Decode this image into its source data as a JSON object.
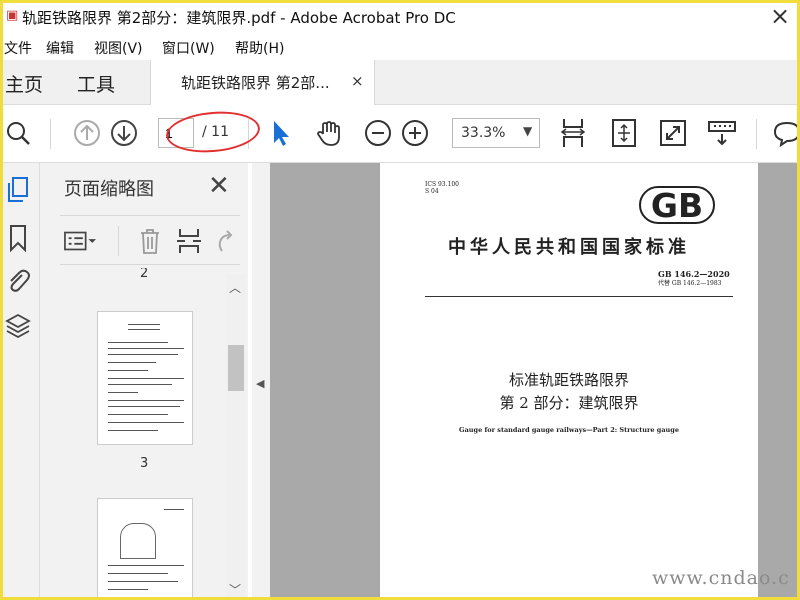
{
  "window": {
    "title": "轨距铁路限界 第2部分：建筑限界.pdf - Adobe Acrobat Pro DC"
  },
  "menu": [
    "文件",
    "编辑",
    "视图(V)",
    "窗口(W)",
    "帮助(H)"
  ],
  "tabs": {
    "home": "主页",
    "tools": "工具",
    "document": "轨距铁路限界 第2部...",
    "close_glyph": "×"
  },
  "toolbar": {
    "page_current": "1",
    "page_total": "/ 11",
    "zoom": "33.3%"
  },
  "thumbnail_panel": {
    "title": "页面缩略图",
    "page_labels": [
      "2",
      "3"
    ]
  },
  "document_page": {
    "ics": "ICS 93.100",
    "class": "S 04",
    "logo_text": "GB",
    "national_standard": "中华人民共和国国家标准",
    "code": "GB 146.2—2020",
    "supersedes": "代替 GB 146.2—1983",
    "title_line1": "标准轨距铁路限界",
    "title_line2": "第 2 部分：建筑限界",
    "title_en": "Gauge for standard gauge railways—Part 2: Structure gauge"
  },
  "watermark": "www.cndao.c",
  "colors": {
    "annotation": "#e23030",
    "frame": "#f0dc3a",
    "accent": "#1a6fd6"
  }
}
